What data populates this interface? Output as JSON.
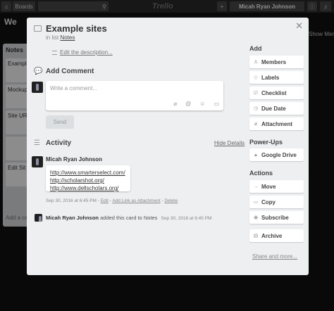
{
  "topbar": {
    "boards_label": "Boards",
    "logo_text": "Trello",
    "user_name": "Micah Ryan Johnson",
    "show_menu": "Show Menu"
  },
  "board": {
    "title": "We",
    "list_title": "Notes",
    "cards": [
      "Exampl",
      "Mockup",
      "Site UR",
      "",
      "Edit Sit"
    ],
    "add_card": "Add a ca"
  },
  "card": {
    "title": "Example sites",
    "in_list_prefix": "in list",
    "list_name": "Notes",
    "edit_description": "Edit the description..."
  },
  "comment": {
    "heading": "Add Comment",
    "placeholder": "Write a comment...",
    "send_label": "Send"
  },
  "activity": {
    "heading": "Activity",
    "hide_details": "Hide Details",
    "entries": [
      {
        "author": "Micah Ryan Johnson",
        "links": [
          "http://www.smarterselect.com/",
          "http://scholarshot.org/",
          "http://www.dellscholars.org/"
        ],
        "date": "Sep 30, 2016 at 6:45 PM",
        "actions": [
          "Edit",
          "Add Link as Attachment",
          "Delete"
        ]
      },
      {
        "author": "Micah Ryan Johnson",
        "text": "added this card to Notes",
        "date": "Sep 30, 2016 at 6:45 PM"
      }
    ]
  },
  "sidebar": {
    "add_heading": "Add",
    "add_items": [
      "Members",
      "Labels",
      "Checklist",
      "Due Date",
      "Attachment"
    ],
    "powerups_heading": "Power-Ups",
    "powerups_items": [
      "Google Drive"
    ],
    "actions_heading": "Actions",
    "actions_items": [
      "Move",
      "Copy",
      "Subscribe",
      "Archive"
    ],
    "share_more": "Share and more..."
  }
}
